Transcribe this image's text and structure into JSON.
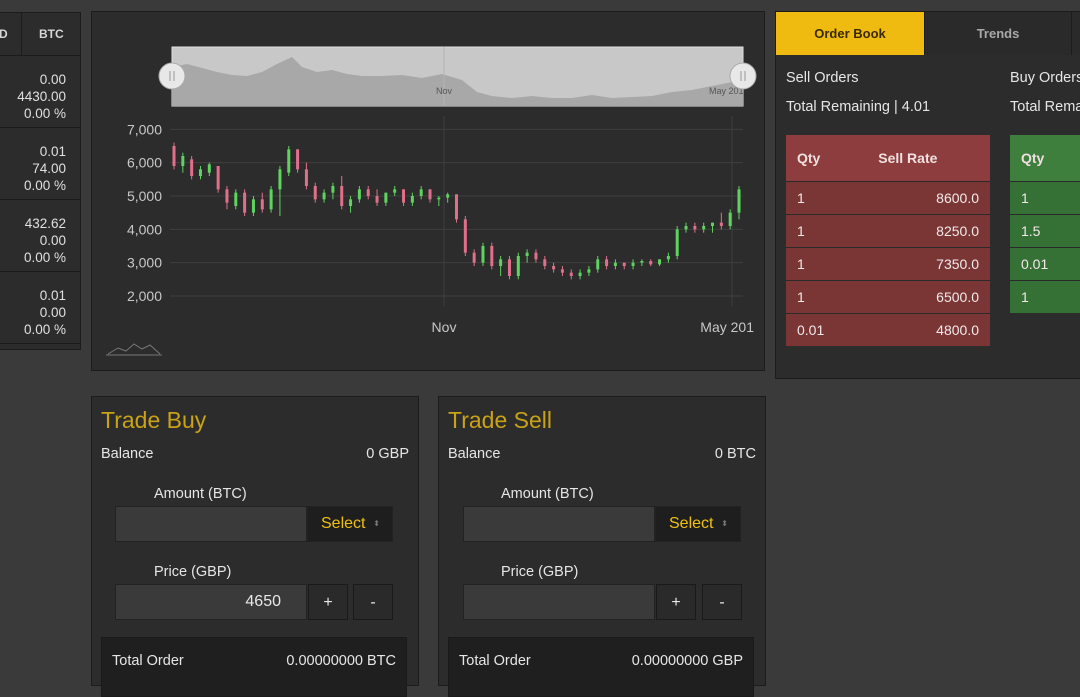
{
  "market": {
    "headers": [
      "D",
      "BTC"
    ],
    "rows": [
      [
        "0.00",
        "4430.00",
        "0.00 %"
      ],
      [
        "0.01",
        "74.00",
        "0.00 %"
      ],
      [
        "432.62",
        "0.00",
        "0.00 %"
      ],
      [
        "0.01",
        "0.00",
        "0.00 %"
      ]
    ]
  },
  "chart": {
    "navigator_labels": [
      "Nov",
      "May 201"
    ]
  },
  "chart_data": {
    "type": "candlestick",
    "y_ticks": [
      "7,000",
      "6,000",
      "5,000",
      "4,000",
      "3,000",
      "2,000"
    ],
    "x_ticks": [
      "Nov",
      "May 201"
    ],
    "ylim": [
      1700,
      7400
    ],
    "grid": true,
    "candles": [
      [
        6500,
        6600,
        5800,
        5900
      ],
      [
        5900,
        6300,
        5700,
        6200
      ],
      [
        6100,
        6200,
        5500,
        5600
      ],
      [
        5600,
        5900,
        5500,
        5800
      ],
      [
        5700,
        6000,
        5600,
        5950
      ],
      [
        5900,
        5900,
        5100,
        5200
      ],
      [
        5200,
        5300,
        4600,
        4800
      ],
      [
        4700,
        5200,
        4600,
        5100
      ],
      [
        5100,
        5200,
        4400,
        4500
      ],
      [
        4500,
        5000,
        4400,
        4900
      ],
      [
        4900,
        5100,
        4500,
        4600
      ],
      [
        4600,
        5300,
        4500,
        5200
      ],
      [
        5200,
        5900,
        4400,
        5800
      ],
      [
        5700,
        6500,
        5600,
        6400
      ],
      [
        6400,
        6400,
        5700,
        5800
      ],
      [
        5800,
        6000,
        5200,
        5300
      ],
      [
        5300,
        5400,
        4800,
        4900
      ],
      [
        4900,
        5200,
        4800,
        5100
      ],
      [
        5100,
        5400,
        4900,
        5300
      ],
      [
        5300,
        5600,
        4600,
        4700
      ],
      [
        4700,
        5000,
        4500,
        4900
      ],
      [
        4900,
        5300,
        4800,
        5200
      ],
      [
        5200,
        5300,
        4900,
        5000
      ],
      [
        5000,
        5200,
        4700,
        4800
      ],
      [
        4800,
        5100,
        4700,
        5100
      ],
      [
        5100,
        5300,
        5000,
        5200
      ],
      [
        5200,
        5200,
        4700,
        4800
      ],
      [
        4800,
        5100,
        4700,
        5000
      ],
      [
        5000,
        5300,
        4900,
        5200
      ],
      [
        5200,
        5200,
        4800,
        4900
      ],
      [
        4900,
        5000,
        4700,
        4950
      ],
      [
        4950,
        5100,
        4800,
        5050
      ],
      [
        5050,
        5050,
        4200,
        4300
      ],
      [
        4300,
        4400,
        3200,
        3300
      ],
      [
        3300,
        3400,
        2900,
        3000
      ],
      [
        3000,
        3600,
        2900,
        3500
      ],
      [
        3500,
        3600,
        2800,
        2900
      ],
      [
        2900,
        3200,
        2600,
        3100
      ],
      [
        3100,
        3200,
        2500,
        2600
      ],
      [
        2600,
        3300,
        2500,
        3200
      ],
      [
        3200,
        3400,
        3000,
        3300
      ],
      [
        3300,
        3400,
        3000,
        3100
      ],
      [
        3100,
        3200,
        2800,
        2900
      ],
      [
        2900,
        3000,
        2700,
        2800
      ],
      [
        2800,
        2900,
        2600,
        2700
      ],
      [
        2700,
        2800,
        2500,
        2600
      ],
      [
        2600,
        2800,
        2500,
        2700
      ],
      [
        2700,
        2900,
        2600,
        2800
      ],
      [
        2800,
        3200,
        2700,
        3100
      ],
      [
        3100,
        3200,
        2800,
        2900
      ],
      [
        2900,
        3100,
        2800,
        3000
      ],
      [
        3000,
        3000,
        2800,
        2900
      ],
      [
        2900,
        3100,
        2800,
        3000
      ],
      [
        3000,
        3100,
        2900,
        3050
      ],
      [
        3050,
        3100,
        2900,
        2950
      ],
      [
        2950,
        3100,
        2900,
        3100
      ],
      [
        3100,
        3300,
        3000,
        3200
      ],
      [
        3200,
        4100,
        3100,
        4000
      ],
      [
        4000,
        4200,
        3900,
        4100
      ],
      [
        4100,
        4200,
        3900,
        4000
      ],
      [
        4000,
        4200,
        3900,
        4100
      ],
      [
        4100,
        4200,
        3900,
        4200
      ],
      [
        4200,
        4500,
        4000,
        4100
      ],
      [
        4100,
        4600,
        4000,
        4500
      ],
      [
        4500,
        5300,
        4300,
        5200
      ]
    ]
  },
  "orderbook": {
    "tabs": [
      "Order Book",
      "Trends"
    ],
    "sell_title": "Sell Orders",
    "sell_total": "Total Remaining | 4.01",
    "buy_title": "Buy Orders",
    "buy_total": "Total Rema",
    "sell_headers": [
      "Qty",
      "Sell Rate"
    ],
    "sell_rows": [
      [
        "1",
        "8600.0"
      ],
      [
        "1",
        "8250.0"
      ],
      [
        "1",
        "7350.0"
      ],
      [
        "1",
        "6500.0"
      ],
      [
        "0.01",
        "4800.0"
      ]
    ],
    "buy_headers": [
      "Qty"
    ],
    "buy_rows": [
      [
        "1"
      ],
      [
        "1.5"
      ],
      [
        "0.01"
      ],
      [
        "1"
      ]
    ]
  },
  "trade_buy": {
    "title": "Trade Buy",
    "balance_label": "Balance",
    "balance_value": "0 GBP",
    "amount_label": "Amount (BTC)",
    "amount_value": "",
    "select_label": "Select",
    "price_label": "Price (GBP)",
    "price_value": "4650",
    "plus": "+",
    "minus": "-",
    "total_label": "Total Order",
    "total_value": "0.00000000 BTC"
  },
  "trade_sell": {
    "title": "Trade Sell",
    "balance_label": "Balance",
    "balance_value": "0 BTC",
    "amount_label": "Amount (BTC)",
    "amount_value": "",
    "select_label": "Select",
    "price_label": "Price (GBP)",
    "price_value": "",
    "plus": "+",
    "minus": "-",
    "total_label": "Total Order",
    "total_value": "0.00000000 GBP"
  },
  "colors": {
    "accent": "#f0bb11",
    "up_candle": "#5fd35f",
    "down_candle": "#e0708a",
    "sell_row": "#7a3535",
    "buy_row": "#357035"
  }
}
